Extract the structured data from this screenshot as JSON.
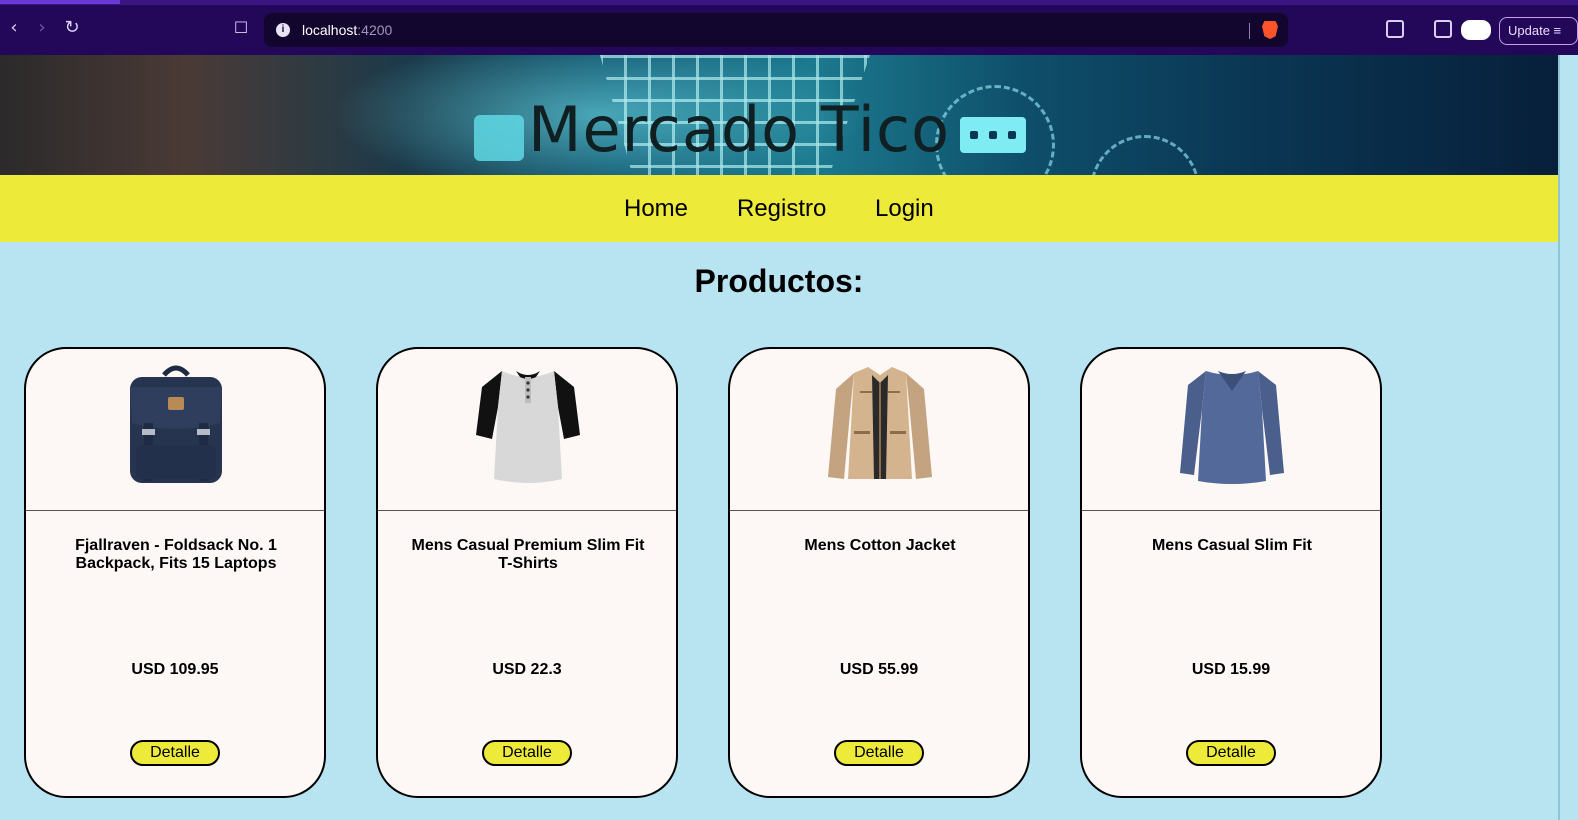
{
  "browser": {
    "url_host": "localhost",
    "url_port": ":4200",
    "update_label": "Update"
  },
  "banner": {
    "title": "Mercado Tico"
  },
  "nav": {
    "items": [
      {
        "label": "Home"
      },
      {
        "label": "Registro"
      },
      {
        "label": "Login"
      }
    ]
  },
  "main": {
    "section_title": "Productos:",
    "detail_label": "Detalle",
    "products": [
      {
        "name": "Fjallraven - Foldsack No. 1 Backpack, Fits 15 Laptops",
        "price": "USD 109.95",
        "image": "backpack"
      },
      {
        "name": "Mens Casual Premium Slim Fit T-Shirts",
        "price": "USD 22.3",
        "image": "raglan-tshirt"
      },
      {
        "name": "Mens Cotton Jacket",
        "price": "USD 55.99",
        "image": "cotton-jacket"
      },
      {
        "name": "Mens Casual Slim Fit",
        "price": "USD 15.99",
        "image": "long-sleeve-shirt"
      }
    ]
  },
  "colors": {
    "browser_bg": "#23085a",
    "nav_bg": "#eeea3a",
    "page_bg": "#b8e3f1",
    "card_bg": "#fdf8f6",
    "button_bg": "#eeea3a"
  }
}
